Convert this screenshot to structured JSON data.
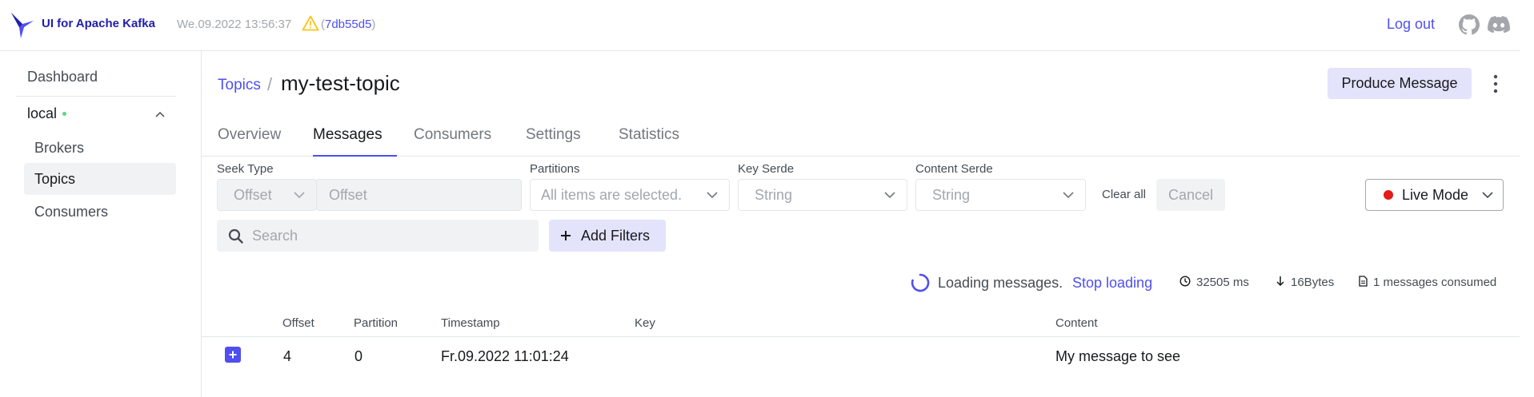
{
  "navbar": {
    "brand": "UI for Apache Kafka",
    "version_date": "We.09.2022 13:56:37",
    "commit_open": "(",
    "commit_hash": "7db55d5",
    "commit_close": ")",
    "logout": "Log out",
    "icons": [
      "kafka-logo-icon",
      "warning-icon",
      "github-icon",
      "discord-icon"
    ]
  },
  "sidebar": {
    "dashboard": "Dashboard",
    "cluster": "local",
    "cluster_status_color": "#5cd685",
    "items": [
      {
        "label": "Brokers"
      },
      {
        "label": "Topics"
      },
      {
        "label": "Consumers"
      }
    ],
    "active_item": "Topics"
  },
  "header": {
    "breadcrumb_root": "Topics",
    "breadcrumb_sep": "/",
    "title": "my-test-topic",
    "produce_button": "Produce Message"
  },
  "tabs": [
    {
      "label": "Overview"
    },
    {
      "label": "Messages"
    },
    {
      "label": "Consumers"
    },
    {
      "label": "Settings"
    },
    {
      "label": "Statistics"
    }
  ],
  "active_tab": "Messages",
  "filters": {
    "seek_type_label": "Seek Type",
    "seek_type_value": "Offset",
    "offset_placeholder": "Offset",
    "partitions_label": "Partitions",
    "partitions_value": "All items are selected.",
    "key_serde_label": "Key Serde",
    "key_serde_value": "String",
    "content_serde_label": "Content Serde",
    "content_serde_value": "String",
    "clear_all": "Clear all",
    "cancel": "Cancel",
    "mode": "Live Mode",
    "search_placeholder": "Search",
    "add_filters": "Add Filters"
  },
  "status": {
    "loading_text": "Loading messages.",
    "stop_loading": "Stop loading",
    "elapsed": "32505 ms",
    "bytes": "16Bytes",
    "consumed": "1 messages consumed"
  },
  "table": {
    "columns": [
      "Offset",
      "Partition",
      "Timestamp",
      "Key",
      "Content"
    ],
    "rows": [
      {
        "offset": "4",
        "partition": "0",
        "timestamp": "Fr.09.2022 11:01:24",
        "key": "",
        "content": "My message to see"
      }
    ]
  },
  "colors": {
    "accent": "#4f4ff0",
    "brand": "#1f1fab",
    "live": "#e51a1a",
    "button_soft": "#e3e3fc"
  }
}
